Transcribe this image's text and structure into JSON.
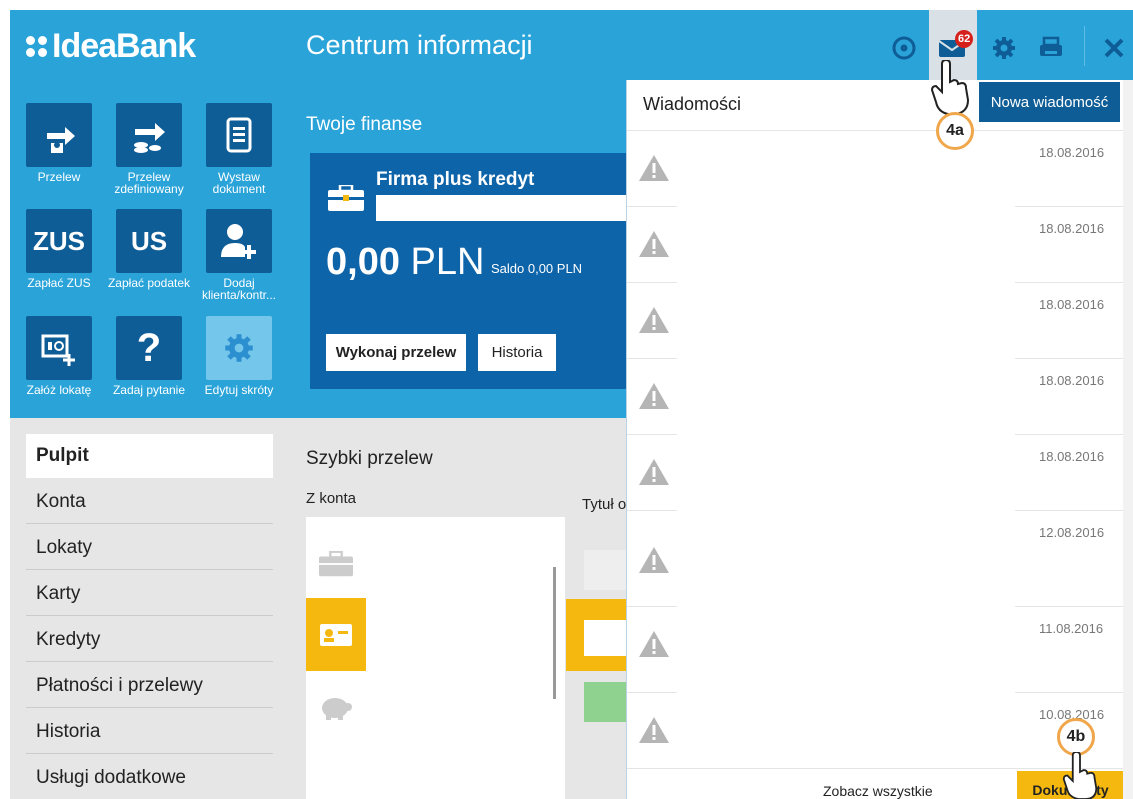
{
  "header": {
    "logo": "IdeaBank",
    "page_title": "Centrum informacji",
    "icons": [
      "help-circle-icon",
      "mail-icon",
      "gear-icon",
      "print-icon",
      "close-icon"
    ],
    "mail_badge": "62"
  },
  "shortcuts": [
    {
      "label": "Przelew",
      "icon": "transfer-icon"
    },
    {
      "label": "Przelew zdefiniowany",
      "icon": "defined-transfer-icon"
    },
    {
      "label": "Wystaw dokument",
      "icon": "document-icon"
    },
    {
      "label": "ZUS",
      "icon": "zus-icon",
      "tile_text": "ZUS",
      "caption": "Zapłać ZUS"
    },
    {
      "label": "US",
      "icon": "us-icon",
      "tile_text": "US",
      "caption": "Zapłać podatek"
    },
    {
      "label": "Dodaj klienta/kontr...",
      "icon": "add-client-icon"
    },
    {
      "label": "Załóż lokatę",
      "icon": "deposit-icon"
    },
    {
      "label": "Zadaj pytanie",
      "icon": "question-icon",
      "tile_text": "?"
    },
    {
      "label": "Edytuj skróty",
      "icon": "gear-icon"
    }
  ],
  "finances": {
    "title": "Twoje finanse",
    "account_name": "Firma plus kredyt",
    "amount_main": "0,00",
    "amount_currency": "PLN",
    "saldo": "Saldo 0,00 PLN",
    "primary_button": "Wykonaj przelew",
    "secondary_button": "Historia"
  },
  "menu": [
    "Pulpit",
    "Konta",
    "Lokaty",
    "Karty",
    "Kredyty",
    "Płatności i przelewy",
    "Historia",
    "Usługi dodatkowe"
  ],
  "quick_transfer": {
    "title": "Szybki przelew",
    "from_label": "Z konta",
    "title_label": "Tytuł o"
  },
  "messages": {
    "title": "Wiadomości",
    "new_button": "Nowa wiadomość",
    "dates": [
      "18.08.2016",
      "18.08.2016",
      "18.08.2016",
      "18.08.2016",
      "18.08.2016",
      "12.08.2016",
      "11.08.2016",
      "10.08.2016"
    ],
    "see_all": "Zobacz wszystkie",
    "documents_button": "Dokumenty"
  },
  "markers": {
    "a": "4a",
    "b": "4b"
  },
  "colors": {
    "header": "#2aa3d9",
    "dark_blue": "#0e5d96",
    "card": "#0e64a9",
    "accent": "#f5b80e",
    "badge": "#d6201c",
    "marker_ring": "#f0a64b"
  }
}
